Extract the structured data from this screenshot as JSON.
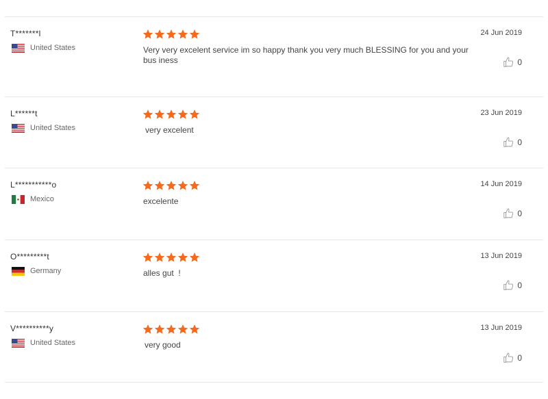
{
  "reviews": [
    {
      "author": "T*******l",
      "country": "United States",
      "flag": "us-flag-icon",
      "rating": 5,
      "comment": "Very very excelent service im so happy thank you very much BLESSING for you and your bus iness",
      "date": "24 Jun 2019",
      "helpful_count": "0"
    },
    {
      "author": "L******t",
      "country": "United States",
      "flag": "us-flag-icon",
      "rating": 5,
      "comment": "very excelent",
      "date": "23 Jun 2019",
      "helpful_count": "0"
    },
    {
      "author": "L***********o",
      "country": "Mexico",
      "flag": "mexico-flag-icon",
      "rating": 5,
      "comment": "excelente",
      "date": "14 Jun 2019",
      "helpful_count": "0"
    },
    {
      "author": "O*********t",
      "country": "Germany",
      "flag": "germany-flag-icon",
      "rating": 5,
      "comment": "alles gut  !",
      "date": "13 Jun 2019",
      "helpful_count": "0"
    },
    {
      "author": "V**********y",
      "country": "United States",
      "flag": "us-flag-icon",
      "rating": 5,
      "comment": "very good",
      "date": "13 Jun 2019",
      "helpful_count": "0"
    }
  ],
  "colors": {
    "star": "#f56a1c",
    "divider": "#e6e6e6",
    "thumb": "#999999"
  }
}
